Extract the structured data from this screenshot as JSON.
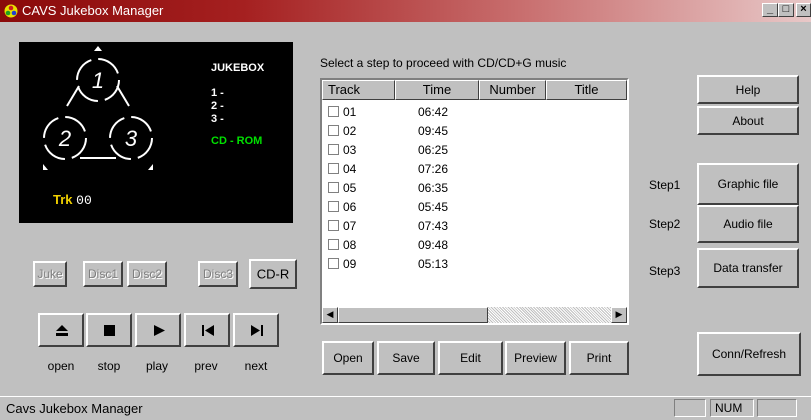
{
  "window": {
    "title": "CAVS Jukebox Manager",
    "controls": {
      "minimize": "_",
      "maximize": "□",
      "close": "×"
    }
  },
  "player": {
    "jukebox_label": "JUKEBOX",
    "slots": [
      "1 -",
      "2 -",
      "3 -"
    ],
    "mode": "CD - ROM",
    "disc_numbers": [
      "1",
      "2",
      "3"
    ],
    "track_label": "Trk",
    "track_value": "00",
    "colors": {
      "mode": "#00e000",
      "track": "#f0d000"
    }
  },
  "disc_buttons": {
    "juke": "Juke",
    "disc1": "Disc1",
    "disc2": "Disc2",
    "disc3": "Disc3",
    "cdr": "CD-R"
  },
  "transport": {
    "open": {
      "label": "open",
      "icon": "eject-icon"
    },
    "stop": {
      "label": "stop",
      "icon": "stop-icon"
    },
    "play": {
      "label": "play",
      "icon": "play-icon"
    },
    "prev": {
      "label": "prev",
      "icon": "prev-track-icon"
    },
    "next": {
      "label": "next",
      "icon": "next-track-icon"
    }
  },
  "instructions": "Select a step to proceed with CD/CD+G music",
  "track_list": {
    "columns": [
      "Track",
      "Time",
      "Number",
      "Title"
    ],
    "rows": [
      {
        "track": "01",
        "time": "06:42"
      },
      {
        "track": "02",
        "time": "09:45"
      },
      {
        "track": "03",
        "time": "06:25"
      },
      {
        "track": "04",
        "time": "07:26"
      },
      {
        "track": "05",
        "time": "06:35"
      },
      {
        "track": "06",
        "time": "05:45"
      },
      {
        "track": "07",
        "time": "07:43"
      },
      {
        "track": "08",
        "time": "09:48"
      },
      {
        "track": "09",
        "time": "05:13"
      }
    ]
  },
  "list_actions": {
    "open": "Open",
    "save": "Save",
    "edit": "Edit",
    "preview": "Preview",
    "print": "Print"
  },
  "right_panel": {
    "help": "Help",
    "about": "About",
    "steps": [
      {
        "label": "Step1",
        "button": "Graphic file"
      },
      {
        "label": "Step2",
        "button": "Audio file"
      },
      {
        "label": "Step3",
        "button": "Data transfer"
      }
    ],
    "conn_refresh": "Conn/Refresh"
  },
  "status": {
    "text": "Cavs Jukebox Manager",
    "num": "NUM"
  }
}
